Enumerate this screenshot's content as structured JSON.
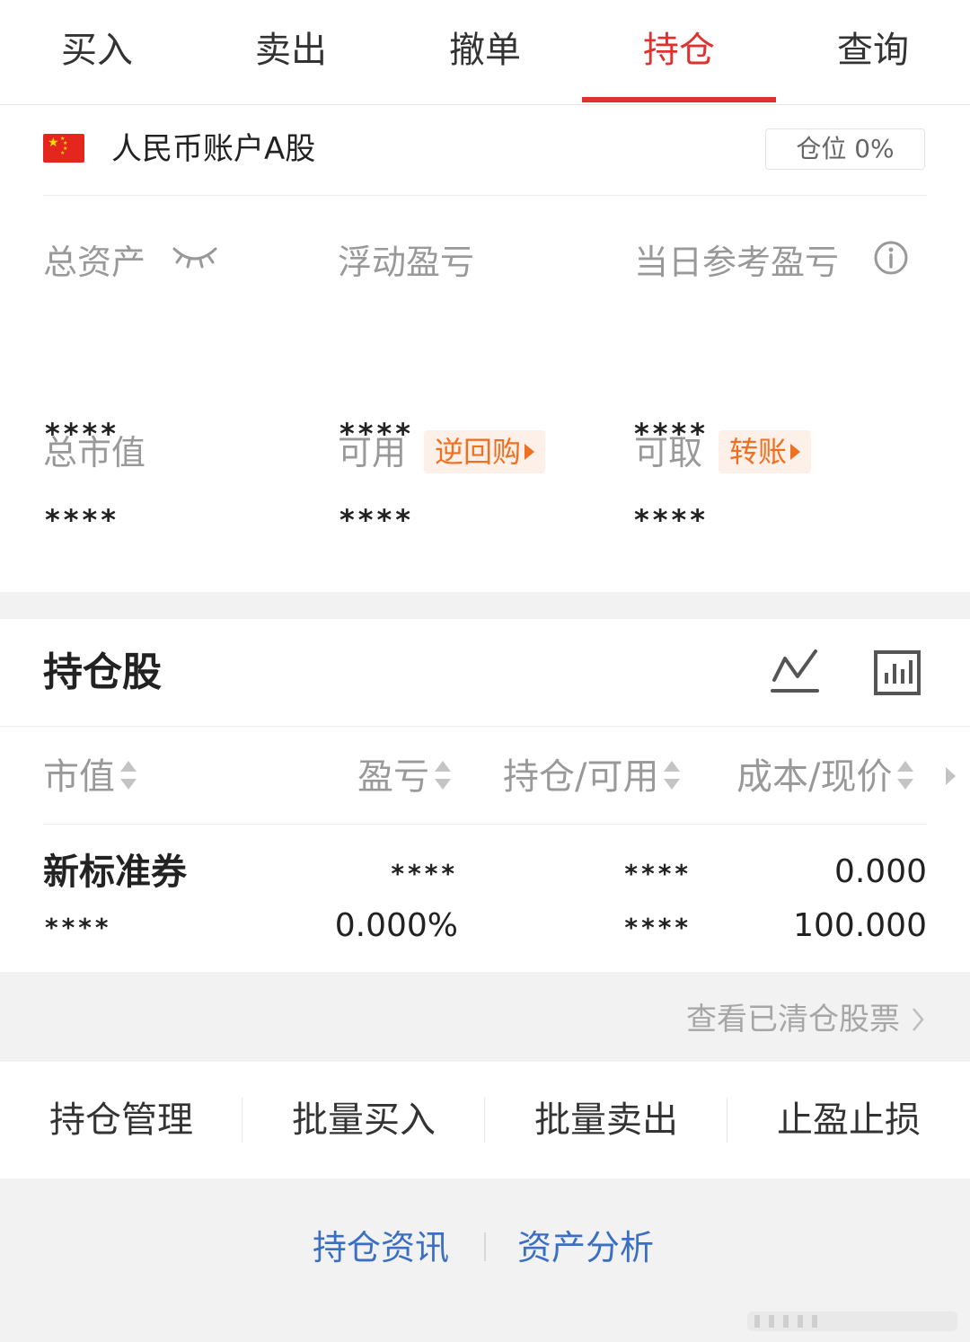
{
  "tabs": [
    {
      "label": "买入",
      "active": false
    },
    {
      "label": "卖出",
      "active": false
    },
    {
      "label": "撤单",
      "active": false
    },
    {
      "label": "持仓",
      "active": true
    },
    {
      "label": "查询",
      "active": false
    }
  ],
  "account": {
    "flag_icon": "china-flag-icon",
    "title": "人民币账户A股",
    "position_badge": "仓位 0%",
    "metrics": {
      "total_assets": {
        "label": "总资产",
        "value": "****",
        "icon": "eye-closed-icon"
      },
      "floating_pnl": {
        "label": "浮动盈亏",
        "value": "****"
      },
      "daily_pnl": {
        "label": "当日参考盈亏",
        "value": "****",
        "icon": "info-icon"
      },
      "market_value": {
        "label": "总市值",
        "value": "****"
      },
      "available": {
        "label": "可用",
        "value": "****",
        "chip": "逆回购"
      },
      "withdrawable": {
        "label": "可取",
        "value": "****",
        "chip": "转账"
      }
    }
  },
  "holdings": {
    "title": "持仓股",
    "columns": [
      "市值",
      "盈亏",
      "持仓/可用",
      "成本/现价"
    ],
    "rows": [
      {
        "name": "新标准券",
        "market_value": "****",
        "pnl": "****",
        "pnl_pct": "0.000%",
        "holding": "****",
        "available": "****",
        "cost": "0.000",
        "price": "100.000"
      }
    ]
  },
  "cleared_link": "查看已清仓股票",
  "actions": [
    "持仓管理",
    "批量买入",
    "批量卖出",
    "止盈止损"
  ],
  "bottom_links": [
    "持仓资讯",
    "资产分析"
  ],
  "colors": {
    "accent": "#e0312f",
    "chip_text": "#f07021",
    "chip_bg": "#fdf0e8",
    "link": "#3a6fc4",
    "muted": "#999999"
  }
}
